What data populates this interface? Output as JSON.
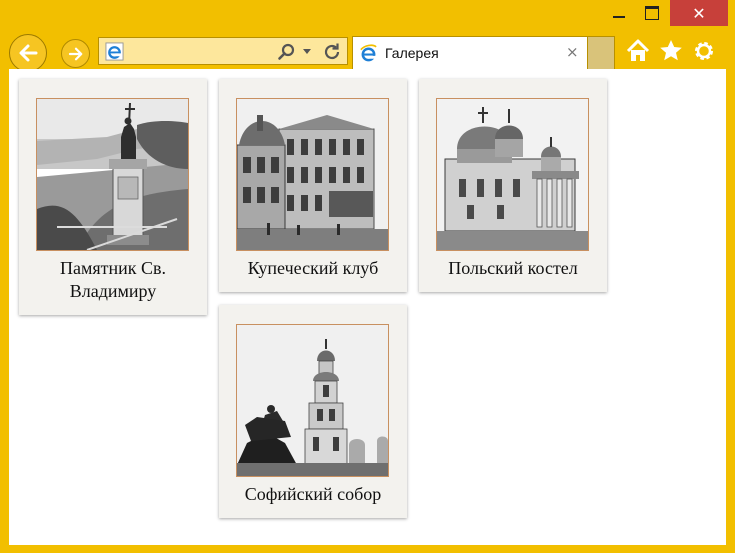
{
  "browser": {
    "tab_title": "Галерея",
    "tab_close": "×",
    "window_close": "✕"
  },
  "gallery": {
    "items": [
      {
        "caption": "Памятник Св. Владимиру"
      },
      {
        "caption": "Купеческий клуб"
      },
      {
        "caption": "Польский костел"
      },
      {
        "caption": "Софийский собор"
      }
    ]
  }
}
